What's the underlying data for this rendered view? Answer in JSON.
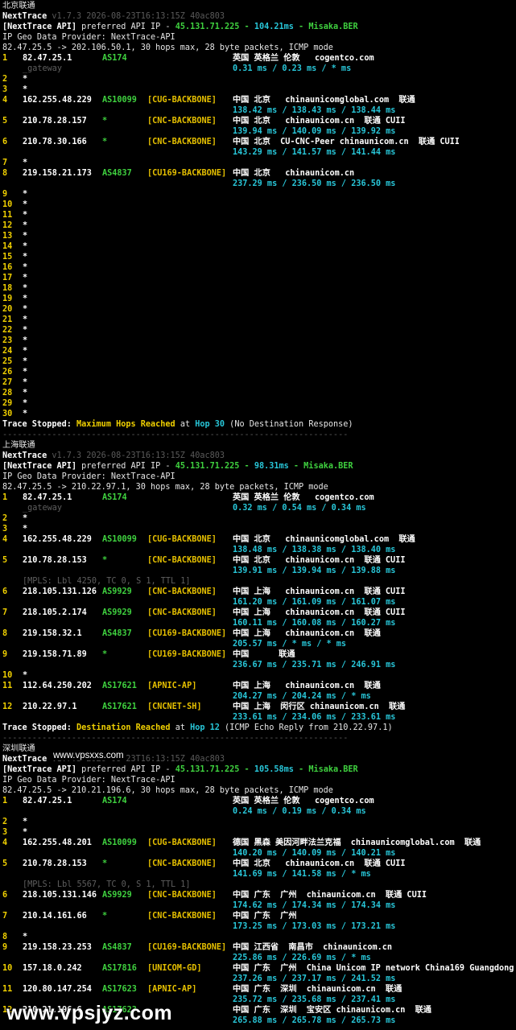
{
  "sections": [
    {
      "id": "bj",
      "title": "北京联通",
      "app_name": "NextTrace",
      "version_line": "v1.7.3 2026-08-23T16:13:15Z 40ac803",
      "api_prefix": "[NextTrace API]",
      "api_mid": " preferred API IP - ",
      "api_ip": "45.131.71.225",
      "api_sep1": " - ",
      "api_ms": "104.21ms",
      "api_sep2": " - ",
      "api_node": "Misaka.BER",
      "geo_provider": "IP Geo Data Provider: NextTrace-API",
      "route_line": "82.47.25.5 -> 202.106.50.1, 30 hops max, 28 byte packets, ICMP mode",
      "hops": [
        {
          "n": "1",
          "ip": "82.47.25.1",
          "as": "AS174",
          "tag": "",
          "geo": "英国 英格兰 伦敦   cogentco.com",
          "sub": "_gateway",
          "rtt": "0.31 ms / 0.23 ms / * ms"
        },
        {
          "n": "2",
          "ip": "*"
        },
        {
          "n": "3",
          "ip": "*"
        },
        {
          "n": "4",
          "ip": "162.255.48.229",
          "as": "AS10099",
          "tag": "[CUG-BACKBONE]",
          "geo": "中国 北京   chinaunicomglobal.com  联通",
          "rtt": "138.42 ms / 138.43 ms / 138.44 ms"
        },
        {
          "n": "5",
          "ip": "210.78.28.157",
          "as": "*",
          "tag": "[CNC-BACKBONE]",
          "geo": "中国 北京   chinaunicom.cn  联通 CUII",
          "rtt": "139.94 ms / 140.09 ms / 139.92 ms"
        },
        {
          "n": "6",
          "ip": "210.78.30.166",
          "as": "*",
          "tag": "[CNC-BACKBONE]",
          "geo": "中国 北京  CU-CNC-Peer chinaunicom.cn  联通 CUII",
          "rtt": "143.29 ms / 141.57 ms / 141.44 ms"
        },
        {
          "n": "7",
          "ip": "*"
        },
        {
          "n": "8",
          "ip": "219.158.21.173",
          "as": "AS4837",
          "tag": "[CU169-BACKBONE]",
          "geo": "中国 北京   chinaunicom.cn",
          "rtt": "237.29 ms / 236.50 ms / 236.50 ms"
        },
        {
          "n": "9",
          "ip": "*"
        },
        {
          "n": "10",
          "ip": "*"
        },
        {
          "n": "11",
          "ip": "*"
        },
        {
          "n": "12",
          "ip": "*"
        },
        {
          "n": "13",
          "ip": "*"
        },
        {
          "n": "14",
          "ip": "*"
        },
        {
          "n": "15",
          "ip": "*"
        },
        {
          "n": "16",
          "ip": "*"
        },
        {
          "n": "17",
          "ip": "*"
        },
        {
          "n": "18",
          "ip": "*"
        },
        {
          "n": "19",
          "ip": "*"
        },
        {
          "n": "20",
          "ip": "*"
        },
        {
          "n": "21",
          "ip": "*"
        },
        {
          "n": "22",
          "ip": "*"
        },
        {
          "n": "23",
          "ip": "*"
        },
        {
          "n": "24",
          "ip": "*"
        },
        {
          "n": "25",
          "ip": "*"
        },
        {
          "n": "26",
          "ip": "*"
        },
        {
          "n": "27",
          "ip": "*"
        },
        {
          "n": "28",
          "ip": "*"
        },
        {
          "n": "29",
          "ip": "*"
        },
        {
          "n": "30",
          "ip": "*"
        }
      ],
      "stop_label": "Trace Stopped: ",
      "stop_reason": "Maximum Hops Reached",
      "stop_at": " at ",
      "stop_hop": "Hop 30",
      "stop_tail": " (No Destination Response)"
    },
    {
      "id": "sh",
      "title": "上海联通",
      "app_name": "NextTrace",
      "version_line": "v1.7.3 2026-08-23T16:13:15Z 40ac803",
      "api_prefix": "[NextTrace API]",
      "api_mid": " preferred API IP - ",
      "api_ip": "45.131.71.225",
      "api_sep1": " - ",
      "api_ms": "98.31ms",
      "api_sep2": " - ",
      "api_node": "Misaka.BER",
      "geo_provider": "IP Geo Data Provider: NextTrace-API",
      "route_line": "82.47.25.5 -> 210.22.97.1, 30 hops max, 28 byte packets, ICMP mode",
      "hops": [
        {
          "n": "1",
          "ip": "82.47.25.1",
          "as": "AS174",
          "tag": "",
          "geo": "英国 英格兰 伦敦   cogentco.com",
          "sub": "_gateway",
          "rtt": "0.32 ms / 0.54 ms / 0.34 ms"
        },
        {
          "n": "2",
          "ip": "*"
        },
        {
          "n": "3",
          "ip": "*"
        },
        {
          "n": "4",
          "ip": "162.255.48.229",
          "as": "AS10099",
          "tag": "[CUG-BACKBONE]",
          "geo": "中国 北京   chinaunicomglobal.com  联通",
          "rtt": "138.48 ms / 138.38 ms / 138.40 ms"
        },
        {
          "n": "5",
          "ip": "210.78.28.153",
          "as": "*",
          "tag": "[CNC-BACKBONE]",
          "geo": "中国 北京   chinaunicom.cn  联通 CUII",
          "rtt": "139.91 ms / 139.94 ms / 139.88 ms"
        },
        {
          "n": "6",
          "ip": "218.105.131.126",
          "as": "AS9929",
          "tag": "[CNC-BACKBONE]",
          "geo": "中国 上海   chinaunicom.cn  联通 CUII",
          "rtt": "161.20 ms / 161.09 ms / 161.07 ms",
          "mpls": "[MPLS: Lbl 4250, TC 0, S 1, TTL 1]"
        },
        {
          "n": "7",
          "ip": "218.105.2.174",
          "as": "AS9929",
          "tag": "[CNC-BACKBONE]",
          "geo": "中国 上海   chinaunicom.cn  联通 CUII",
          "rtt": "160.11 ms / 160.08 ms / 160.27 ms"
        },
        {
          "n": "8",
          "ip": "219.158.32.1",
          "as": "AS4837",
          "tag": "[CU169-BACKBONE]",
          "geo": "中国 上海   chinaunicom.cn  联通",
          "rtt": "205.57 ms / * ms / * ms"
        },
        {
          "n": "9",
          "ip": "219.158.71.89",
          "as": "*",
          "tag": "[CU169-BACKBONE]",
          "geo": "中国      联通",
          "rtt": "236.67 ms / 235.71 ms / 246.91 ms"
        },
        {
          "n": "10",
          "ip": "*"
        },
        {
          "n": "11",
          "ip": "112.64.250.202",
          "as": "AS17621",
          "tag": "[APNIC-AP]",
          "geo": "中国 上海   chinaunicom.cn  联通",
          "rtt": "204.27 ms / 204.24 ms / * ms"
        },
        {
          "n": "12",
          "ip": "210.22.97.1",
          "as": "AS17621",
          "tag": "[CNCNET-SH]",
          "geo": "中国 上海  闵行区 chinaunicom.cn  联通",
          "rtt": "233.61 ms / 234.06 ms / 233.61 ms"
        }
      ],
      "stop_label": "Trace Stopped: ",
      "stop_reason": "Destination Reached",
      "stop_at": " at ",
      "stop_hop": "Hop 12",
      "stop_tail": " (ICMP Echo Reply from 210.22.97.1)"
    },
    {
      "id": "sz",
      "title": "深圳联通",
      "app_name": "NextTrace",
      "version_line": "v1.7.3 2026-08-23T16:13:15Z 40ac803",
      "api_prefix": "[NextTrace API]",
      "api_mid": " preferred API IP - ",
      "api_ip": "45.131.71.225",
      "api_sep1": " - ",
      "api_ms": "105.58ms",
      "api_sep2": " - ",
      "api_node": "Misaka.BER",
      "geo_provider": "IP Geo Data Provider: NextTrace-API",
      "route_line": "82.47.25.5 -> 210.21.196.6, 30 hops max, 28 byte packets, ICMP mode",
      "hops": [
        {
          "n": "1",
          "ip": "82.47.25.1",
          "as": "AS174",
          "tag": "",
          "geo": "英国 英格兰 伦敦   cogentco.com",
          "rtt": "0.24 ms / 0.19 ms / 0.34 ms"
        },
        {
          "n": "2",
          "ip": "*"
        },
        {
          "n": "3",
          "ip": "*"
        },
        {
          "n": "4",
          "ip": "162.255.48.201",
          "as": "AS10099",
          "tag": "[CUG-BACKBONE]",
          "geo": "德国 黑森 美因河畔法兰克福  chinaunicomglobal.com  联通",
          "rtt": "140.20 ms / 140.09 ms / 140.21 ms"
        },
        {
          "n": "5",
          "ip": "210.78.28.153",
          "as": "*",
          "tag": "[CNC-BACKBONE]",
          "geo": "中国 北京   chinaunicom.cn  联通 CUII",
          "rtt": "141.69 ms / 141.58 ms / * ms"
        },
        {
          "n": "6",
          "ip": "218.105.131.146",
          "as": "AS9929",
          "tag": "[CNC-BACKBONE]",
          "geo": "中国 广东  广州  chinaunicom.cn  联通 CUII",
          "rtt": "174.62 ms / 174.34 ms / 174.34 ms",
          "mpls": "[MPLS: Lbl 5567, TC 0, S 1, TTL 1]"
        },
        {
          "n": "7",
          "ip": "210.14.161.66",
          "as": "*",
          "tag": "[CNC-BACKBONE]",
          "geo": "中国 广东  广州",
          "rtt": "173.25 ms / 173.03 ms / 173.21 ms"
        },
        {
          "n": "8",
          "ip": "*"
        },
        {
          "n": "9",
          "ip": "219.158.23.253",
          "as": "AS4837",
          "tag": "[CU169-BACKBONE]",
          "geo": "中国 江西省  南昌市  chinaunicom.cn",
          "rtt": "225.86 ms / 226.69 ms / * ms"
        },
        {
          "n": "10",
          "ip": "157.18.0.242",
          "as": "AS17816",
          "tag": "[UNICOM-GD]",
          "geo": "中国 广东  广州  China Unicom IP network China169 Guangdong",
          "rtt": "237.26 ms / 237.17 ms / 241.52 ms"
        },
        {
          "n": "11",
          "ip": "120.80.147.254",
          "as": "AS17623",
          "tag": "[APNIC-AP]",
          "geo": "中国 广东  深圳  chinaunicom.cn  联通",
          "rtt": "235.72 ms / 235.68 ms / 237.41 ms"
        },
        {
          "n": "12",
          "ip": "210.21.196.6",
          "as": "AS17623",
          "tag": "",
          "geo": "中国 广东  深圳  宝安区 chinaunicom.cn  联通",
          "rtt": "265.88 ms / 265.78 ms / 265.73 ms"
        }
      ]
    }
  ],
  "separator": "----------------------------------------------------------------------",
  "watermark_small": "www.vpsxxs.com",
  "watermark_big": "www.vpsjyz.com"
}
